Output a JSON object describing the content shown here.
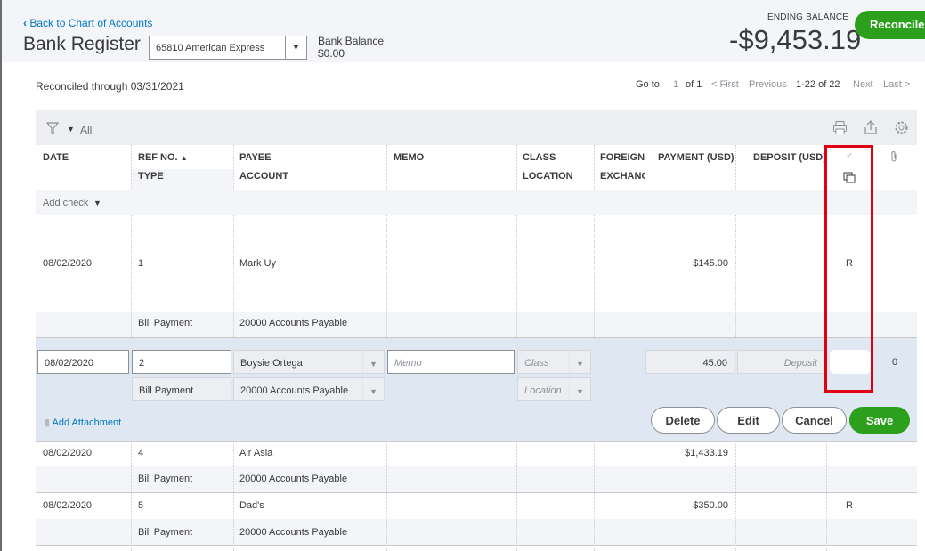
{
  "header": {
    "back_link": "Back to Chart of Accounts",
    "title": "Bank Register",
    "account_selected": "65810 American Express",
    "bank_balance_label": "Bank Balance",
    "bank_balance_value": "$0.00",
    "ending_balance_label": "ENDING BALANCE",
    "ending_balance_value": "-$9,453.19",
    "reconcile_button": "Reconcile"
  },
  "status": {
    "reconciled_through": "Reconciled through 03/31/2021"
  },
  "pager": {
    "goto": "Go to:",
    "page": "1",
    "of": "of 1",
    "first": "< First",
    "previous": "Previous",
    "range": "1-22 of 22",
    "next": "Next",
    "last": "Last >"
  },
  "toolbar": {
    "filter_label": "All"
  },
  "columns": {
    "date": "DATE",
    "ref_no": "REF NO.",
    "type": "TYPE",
    "payee": "PAYEE",
    "account": "ACCOUNT",
    "memo": "MEMO",
    "class": "CLASS",
    "location": "LOCATION",
    "foreign": "FOREIGN",
    "exchange": "EXCHANG",
    "payment": "PAYMENT (USD)",
    "deposit": "DEPOSIT (USD)",
    "reconciled_mark": "✓"
  },
  "add_check": "Add check",
  "rows": [
    {
      "date": "08/02/2020",
      "ref": "1",
      "payee": "Mark Uy",
      "type": "Bill Payment",
      "account": "20000 Accounts Payable",
      "payment": "$145.00",
      "status": "R"
    },
    {
      "date": "08/02/2020",
      "ref": "4",
      "payee": "Air Asia",
      "type": "Bill Payment",
      "account": "20000 Accounts Payable",
      "payment": "$1,433.19",
      "status": ""
    },
    {
      "date": "08/02/2020",
      "ref": "5",
      "payee": "Dad's",
      "type": "Bill Payment",
      "account": "20000 Accounts Payable",
      "payment": "$350.00",
      "status": "R"
    }
  ],
  "edit_row": {
    "date": "08/02/2020",
    "ref": "2",
    "payee": "Boysie Ortega",
    "memo_placeholder": "Memo",
    "class_placeholder": "Class",
    "payment": "45.00",
    "deposit_placeholder": "Deposit",
    "attachments": "0",
    "type": "Bill Payment",
    "account": "20000 Accounts Payable",
    "location_placeholder": "Location",
    "add_attachment": "Add Attachment",
    "buttons": {
      "delete": "Delete",
      "edit": "Edit",
      "cancel": "Cancel",
      "save": "Save"
    }
  },
  "highlight_color": "#e0000f",
  "accent_green": "#2ca01c",
  "link_blue": "#0077c5"
}
